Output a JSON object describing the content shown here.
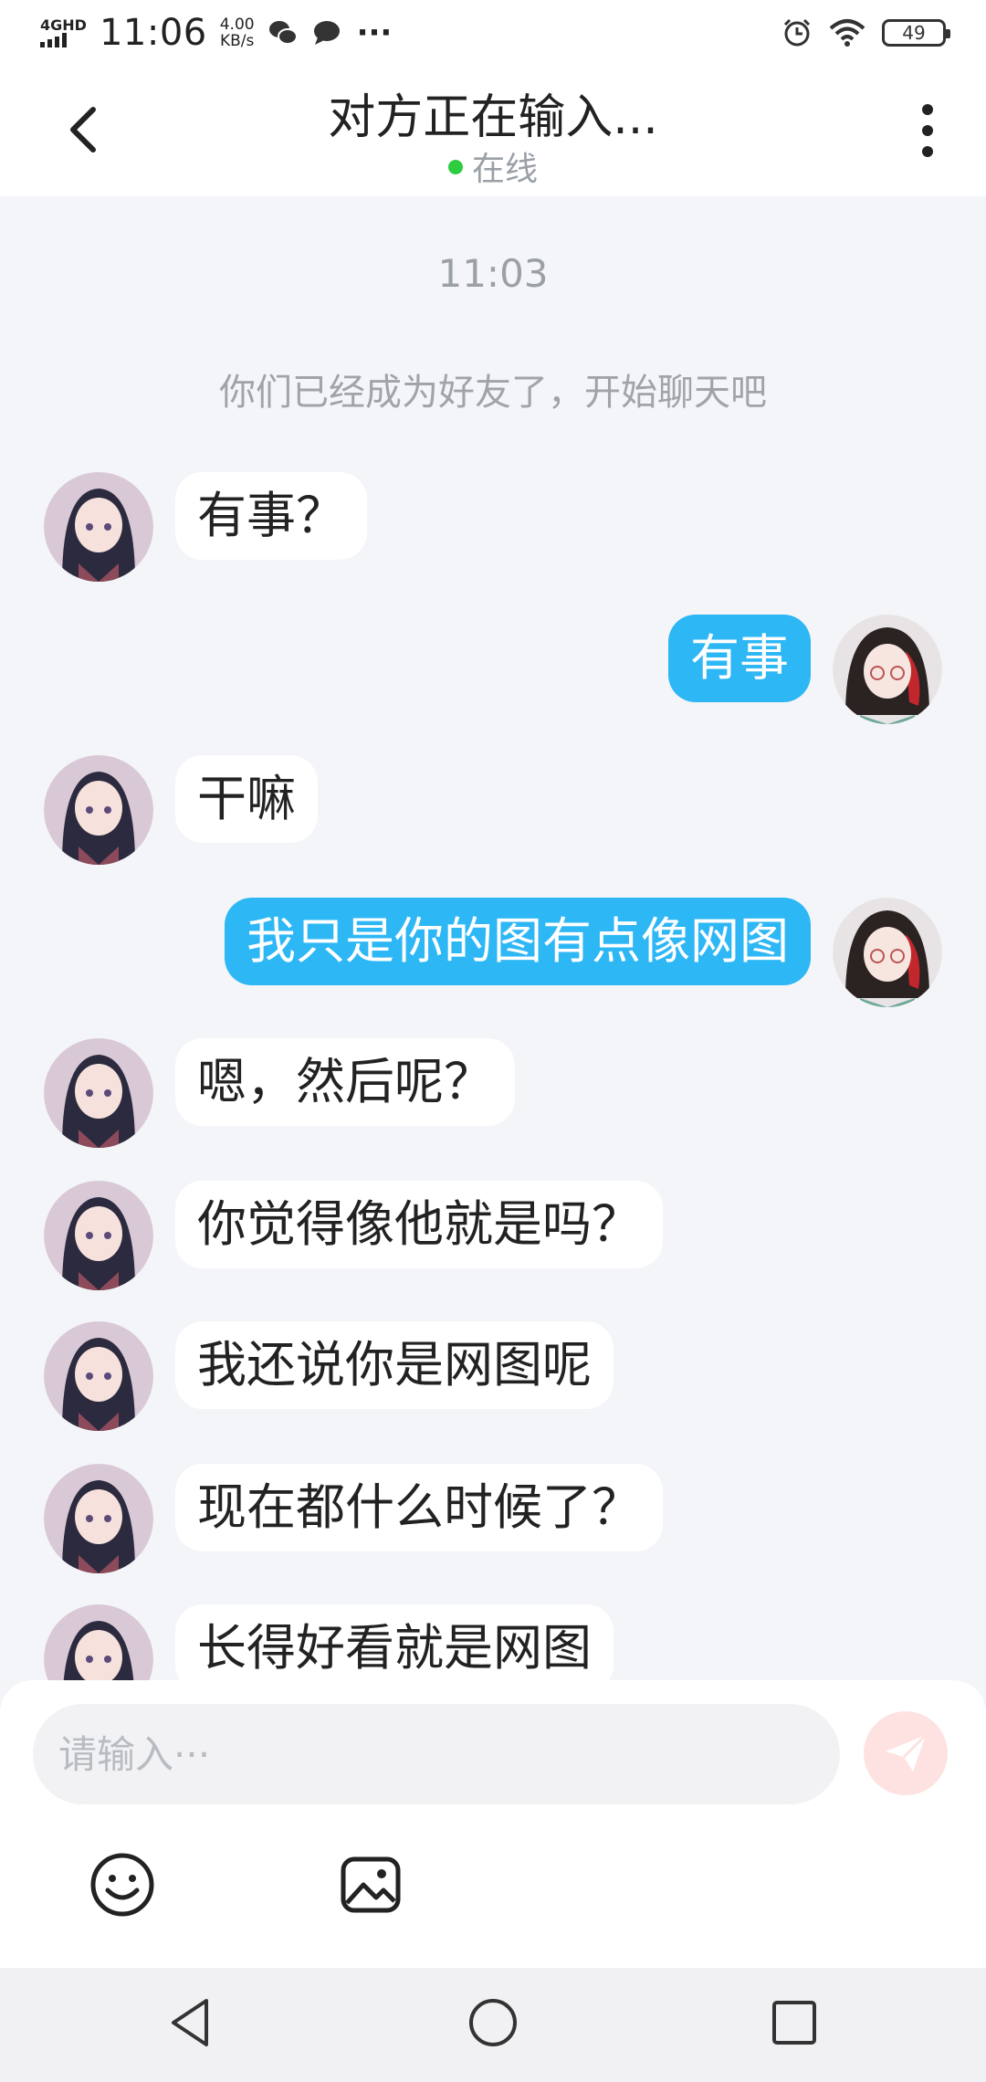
{
  "status_bar": {
    "network": "4GHD",
    "time": "11:06",
    "speed_value": "4.00",
    "speed_unit": "KB/s",
    "more": "···",
    "battery": "49",
    "icons": [
      "wechat-icon",
      "message-icon",
      "alarm-icon",
      "wifi-icon",
      "battery-icon"
    ]
  },
  "header": {
    "title": "对方正在输入...",
    "status": "在线"
  },
  "chat": {
    "timestamp": "11:03",
    "system_message": "你们已经成为好友了，开始聊天吧",
    "messages": [
      {
        "from": "other",
        "text": "有事？"
      },
      {
        "from": "me",
        "text": "有事"
      },
      {
        "from": "other",
        "text": "干嘛"
      },
      {
        "from": "me",
        "text": "我只是你的图有点像网图"
      },
      {
        "from": "other",
        "text": "嗯，然后呢？"
      },
      {
        "from": "other",
        "text": "你觉得像他就是吗？"
      },
      {
        "from": "other",
        "text": "我还说你是网图呢"
      },
      {
        "from": "other",
        "text": "现在都什么时候了？"
      },
      {
        "from": "other",
        "text": "长得好看就是网图"
      }
    ]
  },
  "input": {
    "placeholder": "请输入···"
  },
  "colors": {
    "accent": "#2db7f5",
    "online": "#2ecc40",
    "send_disabled": "#fde2e1"
  }
}
